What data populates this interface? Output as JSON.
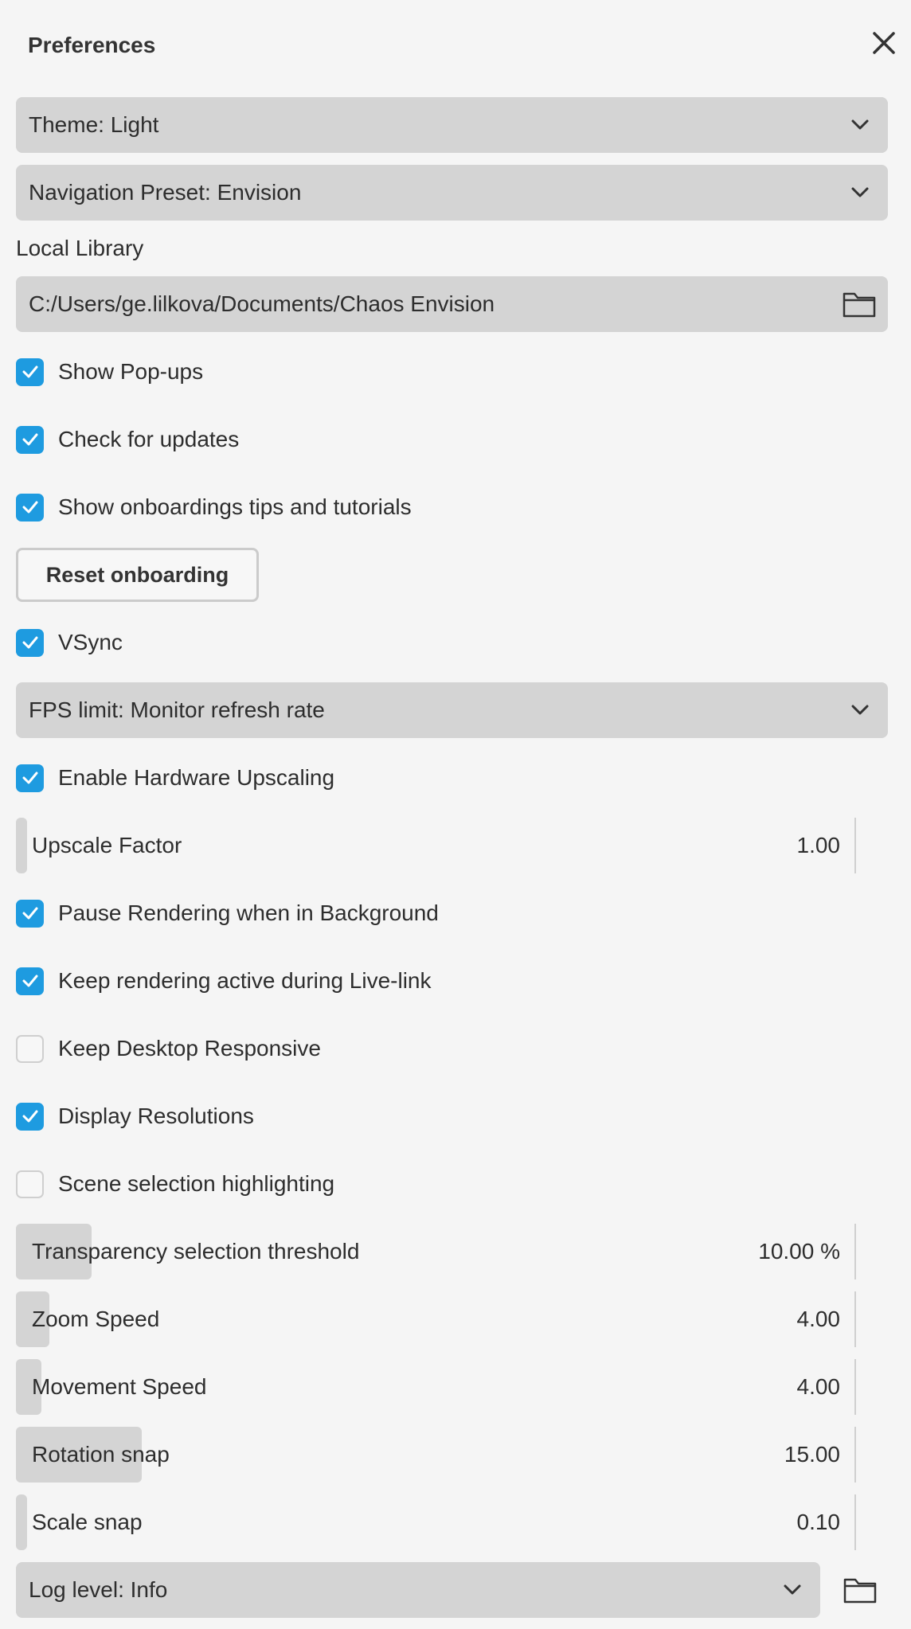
{
  "panel": {
    "title": "Preferences"
  },
  "theme_dropdown": {
    "label": "Theme: Light"
  },
  "navigation_dropdown": {
    "label": "Navigation Preset: Envision"
  },
  "local_library": {
    "label": "Local Library",
    "path": "C:/Users/ge.lilkova/Documents/Chaos Envision"
  },
  "checkboxes": {
    "show_popups": {
      "label": "Show Pop-ups",
      "checked": true
    },
    "check_updates": {
      "label": "Check for updates",
      "checked": true
    },
    "onboarding_tips": {
      "label": "Show onboardings tips and tutorials",
      "checked": true
    },
    "vsync": {
      "label": "VSync",
      "checked": true
    },
    "hw_upscaling": {
      "label": "Enable Hardware Upscaling",
      "checked": true
    },
    "pause_rendering": {
      "label": "Pause Rendering when in Background",
      "checked": true
    },
    "keep_live_link": {
      "label": "Keep rendering active during Live-link",
      "checked": true
    },
    "desktop_responsive": {
      "label": "Keep Desktop Responsive",
      "checked": false
    },
    "display_resolutions": {
      "label": "Display Resolutions",
      "checked": true
    },
    "scene_highlighting": {
      "label": "Scene selection highlighting",
      "checked": false
    }
  },
  "reset_onboarding": {
    "label": "Reset onboarding"
  },
  "fps_dropdown": {
    "label": "FPS limit: Monitor refresh rate"
  },
  "sliders": {
    "upscale_factor": {
      "label": "Upscale Factor",
      "value": "1.00",
      "fill_fraction": 0.01
    },
    "transparency_threshold": {
      "label": "Transparency selection threshold",
      "value": "10.00 %",
      "fill_fraction": 0.09
    },
    "zoom_speed": {
      "label": "Zoom Speed",
      "value": "4.00",
      "fill_fraction": 0.04
    },
    "movement_speed": {
      "label": "Movement Speed",
      "value": "4.00",
      "fill_fraction": 0.03
    },
    "rotation_snap": {
      "label": "Rotation snap",
      "value": "15.00",
      "fill_fraction": 0.15
    },
    "scale_snap": {
      "label": "Scale snap",
      "value": "0.10",
      "fill_fraction": 0.01
    }
  },
  "log_dropdown": {
    "label": "Log level: Info"
  },
  "icons": {
    "close": "close-icon",
    "chevron": "chevron-down-icon",
    "folder": "folder-icon",
    "check": "checkmark-icon"
  },
  "colors": {
    "checkbox_on": "#1e9be0",
    "field_bg": "#d4d4d4",
    "panel_bg": "#f5f5f5"
  }
}
